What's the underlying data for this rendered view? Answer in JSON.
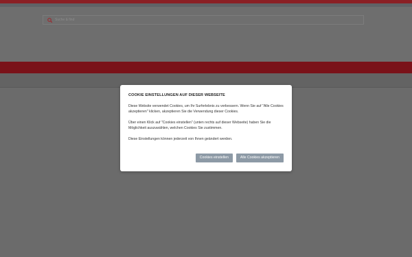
{
  "search": {
    "placeholder": "Suche & find"
  },
  "cookie_modal": {
    "title": "COOKIE EINSTELLUNGEN AUF DIESER WEBSEITE",
    "paragraphs": [
      "Diese Website verwendet Cookies, um Ihr Surferlebnis zu verbessern. Wenn Sie auf \"Alle Cookies akzeptieren\" klicken, akzeptieren Sie die Verwendung dieser Cookies.",
      "Über einen Klick auf \"Cookies einstellen\" (unten rechts auf dieser Webseite) haben Sie die Möglichkeit auszuwählen, welchen Cookies Sie zustimmen.",
      "Diese Einstellungen können jederzeit von Ihnen geändert werden."
    ],
    "settings_button": "Cookies einstellen",
    "accept_button": "Alle Cookies akzeptieren"
  },
  "colors": {
    "brand_red": "#7a1219",
    "button": "#8d9aa6",
    "overlay": "#6b6b6b"
  }
}
